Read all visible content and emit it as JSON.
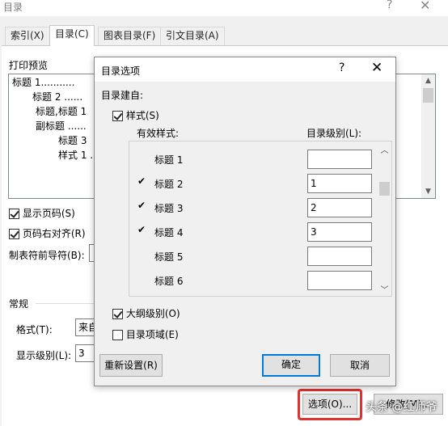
{
  "window": {
    "title": "目录",
    "help": "?",
    "close": "✕"
  },
  "tabs": [
    {
      "label": "索引(X)",
      "active": false
    },
    {
      "label": "目录(C)",
      "active": true
    },
    {
      "label": "图表目录(F)",
      "active": false
    },
    {
      "label": "引文目录(A)",
      "active": false
    }
  ],
  "print_preview": {
    "label": "打印预览",
    "lines": [
      "标题 1...........",
      "标题 2 ......",
      "标题,标题 1",
      "副标题 ......",
      "标题 3",
      "样式 1 ."
    ]
  },
  "options": {
    "show_page_numbers": "显示页码(S)",
    "right_align": "页码右对齐(R)",
    "tab_leader": "制表符前导符(B):"
  },
  "general": {
    "heading": "常规",
    "format_label": "格式(T):",
    "format_value": "来自",
    "levels_label": "显示级别(L):",
    "levels_value": "3"
  },
  "bottom_buttons": {
    "options": "选项(O)...",
    "modify": "修改(M)..."
  },
  "watermark": "头条 @红师爷",
  "inner_dialog": {
    "title": "目录选项",
    "help": "?",
    "close": "✕",
    "build_from": "目录建自:",
    "styles_label": "样式(S)",
    "col_available": "有效样式:",
    "col_level": "目录级别(L):",
    "rows": [
      {
        "name": "标题 1",
        "checked": false,
        "level": ""
      },
      {
        "name": "标题 2",
        "checked": true,
        "level": "1"
      },
      {
        "name": "标题 3",
        "checked": true,
        "level": "2"
      },
      {
        "name": "标题 4",
        "checked": true,
        "level": "3"
      },
      {
        "name": "标题 5",
        "checked": false,
        "level": ""
      },
      {
        "name": "标题 6",
        "checked": false,
        "level": ""
      }
    ],
    "outline_levels": "大纲级别(O)",
    "toc_fields": "目录项域(E)",
    "reset": "重新设置(R)",
    "ok": "确定",
    "cancel": "取消"
  }
}
